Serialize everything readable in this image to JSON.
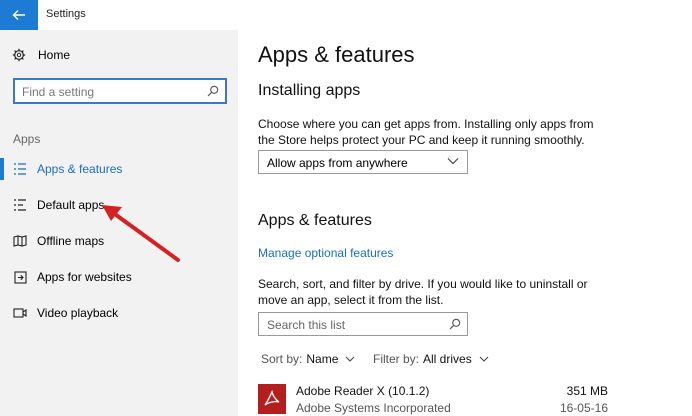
{
  "window": {
    "title": "Settings"
  },
  "colors": {
    "accent": "#1e7bd4",
    "link": "#1a6dc1",
    "sidebar_bg": "#f2f2f2",
    "arrow": "#d42121",
    "app_icon_bg": "#b51e1e"
  },
  "sidebar": {
    "home_label": "Home",
    "search_placeholder": "Find a setting",
    "section_label": "Apps",
    "items": [
      {
        "label": "Apps & features",
        "icon": "list-icon",
        "active": true
      },
      {
        "label": "Default apps",
        "icon": "default-apps-icon",
        "active": false
      },
      {
        "label": "Offline maps",
        "icon": "map-icon",
        "active": false
      },
      {
        "label": "Apps for websites",
        "icon": "open-in-app-icon",
        "active": false
      },
      {
        "label": "Video playback",
        "icon": "video-icon",
        "active": false
      }
    ]
  },
  "main": {
    "page_title": "Apps & features",
    "installing_heading": "Installing apps",
    "installing_description": "Choose where you can get apps from. Installing only apps from the Store helps protect your PC and keep it running smoothly.",
    "install_source_value": "Allow apps from anywhere",
    "apps_heading": "Apps & features",
    "manage_link": "Manage optional features",
    "search_description": "Search, sort, and filter by drive. If you would like to uninstall or move an app, select it from the list.",
    "search_placeholder": "Search this list",
    "sort_label": "Sort by:",
    "sort_value": "Name",
    "filter_label": "Filter by:",
    "filter_value": "All drives",
    "apps": [
      {
        "name": "Adobe Reader X (10.1.2)",
        "publisher": "Adobe Systems Incorporated",
        "size": "351 MB",
        "date": "16-05-16"
      }
    ]
  }
}
